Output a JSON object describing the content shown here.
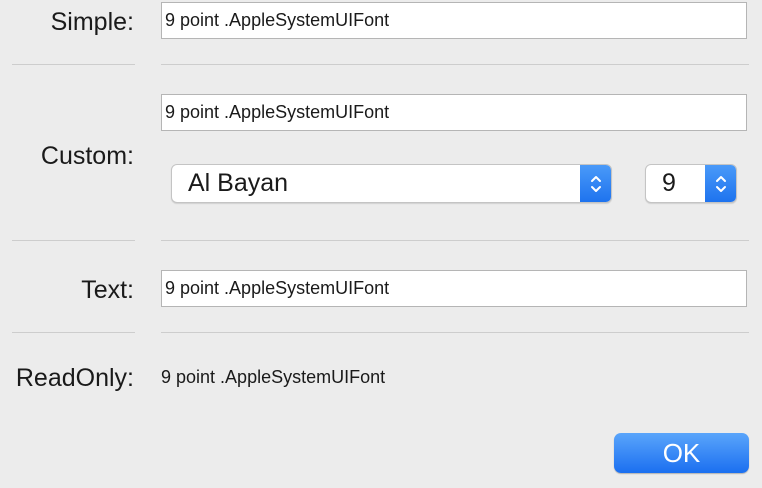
{
  "rows": {
    "simple": {
      "label": "Simple:",
      "value": "9 point .AppleSystemUIFont"
    },
    "custom": {
      "label": "Custom:",
      "value": "9 point .AppleSystemUIFont",
      "font_family": "Al Bayan",
      "font_size": "9"
    },
    "text": {
      "label": "Text:",
      "value": "9 point .AppleSystemUIFont"
    },
    "readonly": {
      "label": "ReadOnly:",
      "value": "9 point .AppleSystemUIFont"
    }
  },
  "buttons": {
    "ok_label": "OK"
  },
  "colors": {
    "accent": "#1d72ee",
    "window_background": "#ececec"
  },
  "icons": {
    "popup_arrows": "chevron-up-down-icon"
  }
}
